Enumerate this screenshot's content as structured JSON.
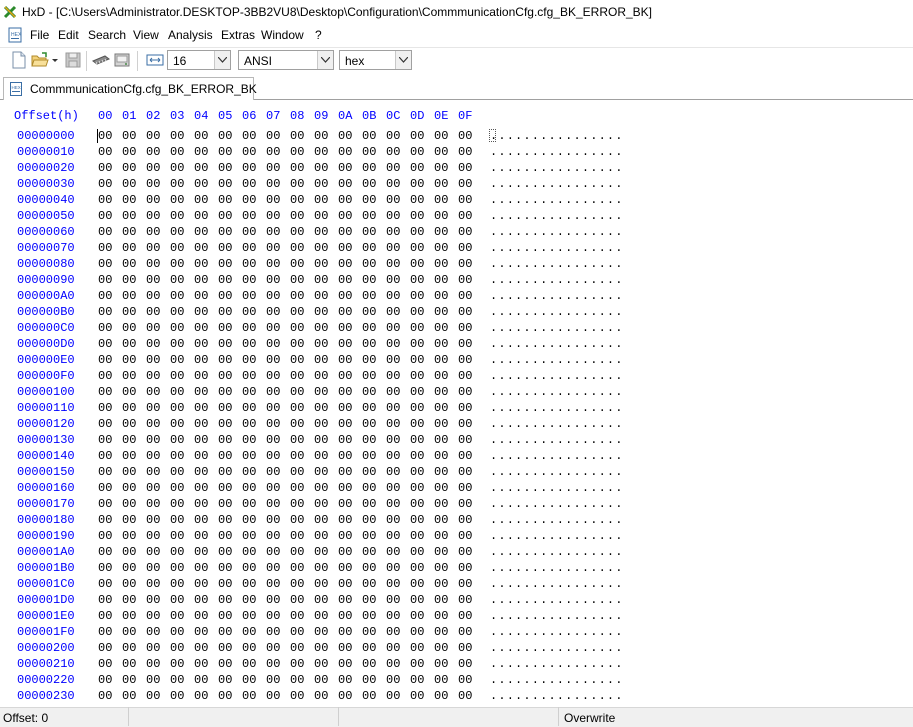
{
  "window": {
    "title": "HxD - [C:\\Users\\Administrator.DESKTOP-3BB2VU8\\Desktop\\Configuration\\CommmunicationCfg.cfg_BK_ERROR_BK]"
  },
  "menu": {
    "items": [
      "File",
      "Edit",
      "Search",
      "View",
      "Analysis",
      "Extras",
      "Window",
      "?"
    ]
  },
  "toolbar": {
    "bytes_per_row": "16",
    "charset": "ANSI",
    "offset_base": "hex",
    "icons": [
      "new-file-icon",
      "open-folder-icon",
      "dropdown-arrow-icon",
      "save-icon",
      "ram-icon",
      "disk-icon",
      "bytes-per-row-icon"
    ]
  },
  "tab": {
    "label": "CommmunicationCfg.cfg_BK_ERROR_BK"
  },
  "editor": {
    "offset_header": "Offset(h)",
    "columns": [
      "00",
      "01",
      "02",
      "03",
      "04",
      "05",
      "06",
      "07",
      "08",
      "09",
      "0A",
      "0B",
      "0C",
      "0D",
      "0E",
      "0F"
    ],
    "byte_value": "00",
    "rows": [
      "00000000",
      "00000010",
      "00000020",
      "00000030",
      "00000040",
      "00000050",
      "00000060",
      "00000070",
      "00000080",
      "00000090",
      "000000A0",
      "000000B0",
      "000000C0",
      "000000D0",
      "000000E0",
      "000000F0",
      "00000100",
      "00000110",
      "00000120",
      "00000130",
      "00000140",
      "00000150",
      "00000160",
      "00000170",
      "00000180",
      "00000190",
      "000001A0",
      "000001B0",
      "000001C0",
      "000001D0",
      "000001E0",
      "000001F0",
      "00000200",
      "00000210",
      "00000220",
      "00000230"
    ],
    "text_row": "................",
    "colors": {
      "offset": "#0000ff",
      "data": "#000000"
    }
  },
  "status": {
    "offset": "Offset: 0",
    "mode": "Overwrite"
  }
}
